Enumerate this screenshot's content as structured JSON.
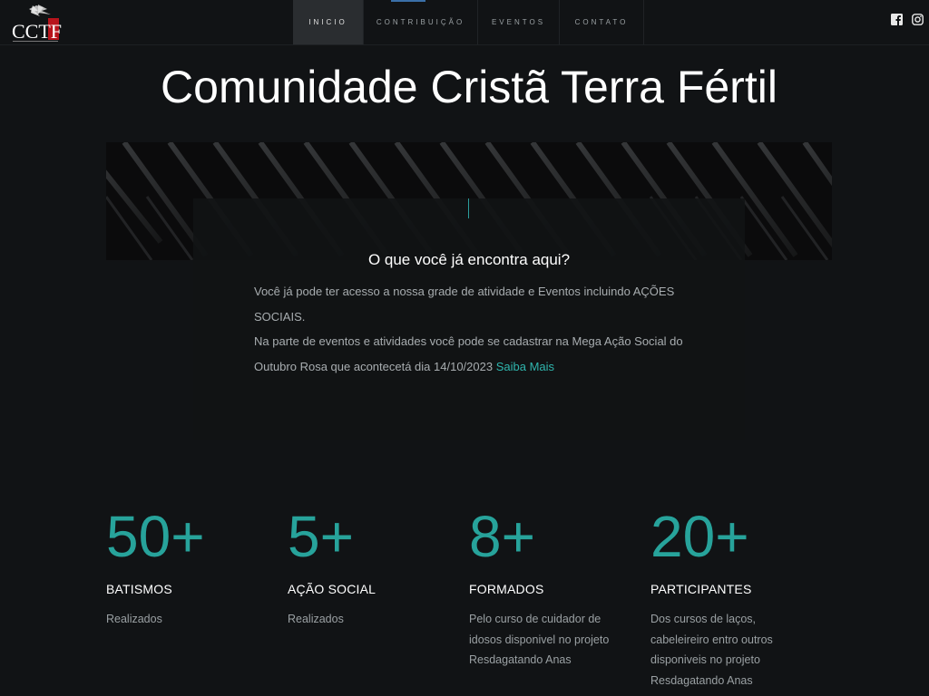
{
  "logo": {
    "text": "CCTF"
  },
  "nav": {
    "items": [
      {
        "label": "INICIO",
        "active": true
      },
      {
        "label": "CONTRIBUIÇÃO",
        "active": false
      },
      {
        "label": "EVENTOS",
        "active": false
      },
      {
        "label": "CONTATO",
        "active": false
      }
    ]
  },
  "social": {
    "icons": [
      "facebook-icon",
      "instagram-icon"
    ]
  },
  "hero": {
    "title": "Comunidade Cristã Terra Fértil"
  },
  "card": {
    "title": "O que você já encontra aqui?",
    "line1": "Você já pode ter acesso a nossa grade de atividade e Eventos incluindo AÇÕES SOCIAIS.",
    "line2": "Na parte de eventos e atividades você pode se cadastrar na Mega Ação Social do Outubro Rosa que acontecetá dia 14/10/2023",
    "link": "Saiba Mais"
  },
  "stats": [
    {
      "number": "50+",
      "label": "BATISMOS",
      "desc": "Realizados"
    },
    {
      "number": "5+",
      "label": "AÇÃO SOCIAL",
      "desc": "Realizados"
    },
    {
      "number": "8+",
      "label": "FORMADOS",
      "desc": "Pelo curso de cuidador de idosos disponivel no projeto Resdagatando Anas"
    },
    {
      "number": "20+",
      "label": "PARTICIPANTES",
      "desc": "Dos cursos de laços, cabeleireiro entro outros disponiveis no projeto Resdagatando Anas"
    }
  ],
  "colors": {
    "accent": "#27a39b",
    "link": "#2fb5ad",
    "background": "#111315"
  }
}
